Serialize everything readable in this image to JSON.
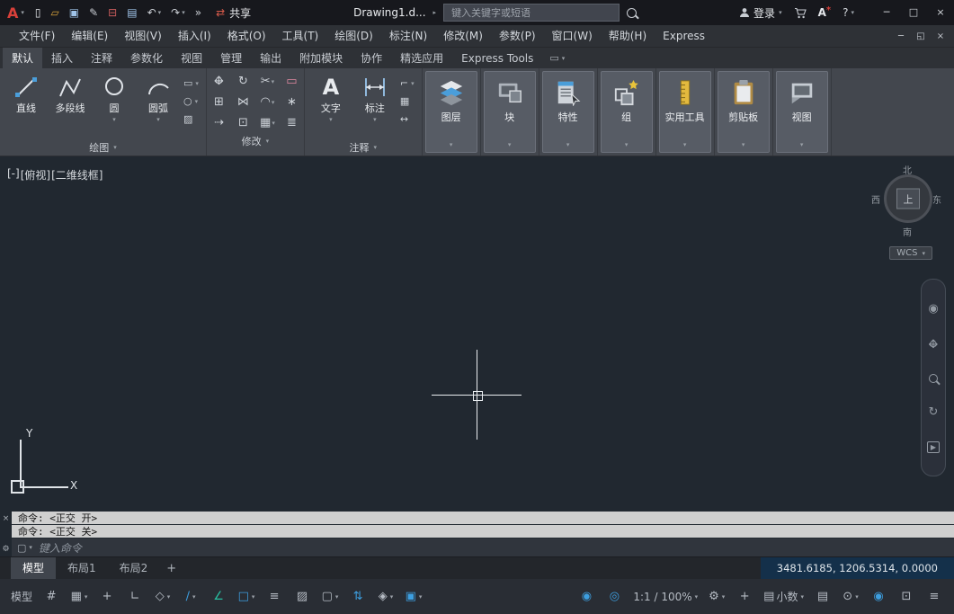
{
  "title_bar": {
    "logo_letter": "A",
    "share": "共享",
    "doc_title": "Drawing1.d...",
    "search_placeholder": "键入关键字或短语",
    "login": "登录",
    "astore_letter": "A",
    "astore_star": "*"
  },
  "menu": {
    "items": [
      "文件(F)",
      "编辑(E)",
      "视图(V)",
      "插入(I)",
      "格式(O)",
      "工具(T)",
      "绘图(D)",
      "标注(N)",
      "修改(M)",
      "参数(P)",
      "窗口(W)",
      "帮助(H)",
      "Express"
    ]
  },
  "ribbon": {
    "tabs": [
      "默认",
      "插入",
      "注释",
      "参数化",
      "视图",
      "管理",
      "输出",
      "附加模块",
      "协作",
      "精选应用",
      "Express Tools"
    ],
    "draw": {
      "label": "绘图",
      "tools": [
        "直线",
        "多段线",
        "圆",
        "圆弧"
      ]
    },
    "modify": {
      "label": "修改"
    },
    "annotate": {
      "label": "注释",
      "text": "文字",
      "dim": "标注"
    },
    "big_panels": {
      "layers": "图层",
      "block": "块",
      "properties": "特性",
      "group": "组",
      "utilities": "实用工具",
      "clipboard": "剪贴板",
      "view": "视图"
    }
  },
  "viewport": {
    "min": "[-]",
    "view": "[俯视]",
    "style": "[二维线框]",
    "cube_n": "北",
    "cube_s": "南",
    "cube_e": "东",
    "cube_w": "西",
    "cube_top": "上",
    "wcs": "WCS",
    "ucs_x": "X",
    "ucs_y": "Y"
  },
  "command": {
    "history": [
      "命令: <正交 开>",
      "命令: <正交 关>"
    ],
    "placeholder": "键入命令"
  },
  "layouts": {
    "model": "模型",
    "layout1": "布局1",
    "layout2": "布局2",
    "add": "+"
  },
  "status": {
    "model": "模型",
    "coords": "3481.6185, 1206.5314, 0.0000",
    "scale": "1:1 / 100%",
    "units": "小数"
  },
  "icons": {
    "caret": "▾",
    "caret_right": "▸",
    "overflow": "»",
    "new_file": "▯",
    "open_folder": "▱",
    "save": "▣",
    "save_as": "✎",
    "plot": "⊟",
    "sheet_set": "▤",
    "undo": "↶",
    "redo": "↷",
    "share": "⇄",
    "help": "?",
    "win_min": "─",
    "win_max": "□",
    "win_restore": "◱",
    "win_close": "×",
    "arrow_h": "↔",
    "arrow_v": "↕",
    "rotate": "↻",
    "trim": "✂",
    "erase": "▭",
    "copy": "⊞",
    "mirror": "⋈",
    "fillet": "◠",
    "explode": "∗",
    "stretch": "⇢",
    "scale_tool": "⊡",
    "array": "▦",
    "offset": "≣",
    "rect": "▭",
    "ellipse": "○",
    "hatch": "▨",
    "leader": "⌐",
    "table": "▦",
    "dim_linear": "↔",
    "grid": "#",
    "snap": "▦",
    "dyn_input": "+",
    "ortho": "∟",
    "iso": "◇",
    "polar": "∕",
    "otrack": "∠",
    "osnap": "□",
    "lineweight": "≡",
    "transparency": "▨",
    "sel_cycle": "▢",
    "ducs": "⇅",
    "osnap3d": "◈",
    "gizmo": "▣",
    "anno_vis": "◉",
    "auto_scale": "◎",
    "gear": "⚙",
    "plus": "+",
    "doc": "▤",
    "lock": "⊙",
    "perf": "◉",
    "clean": "⊡",
    "menu": "≡",
    "nav_wheel": "◉",
    "nav_orbit": "↻",
    "nav_play": "▶",
    "prompt_box": "▢",
    "wrench": "⚙",
    "close_x": "×"
  }
}
